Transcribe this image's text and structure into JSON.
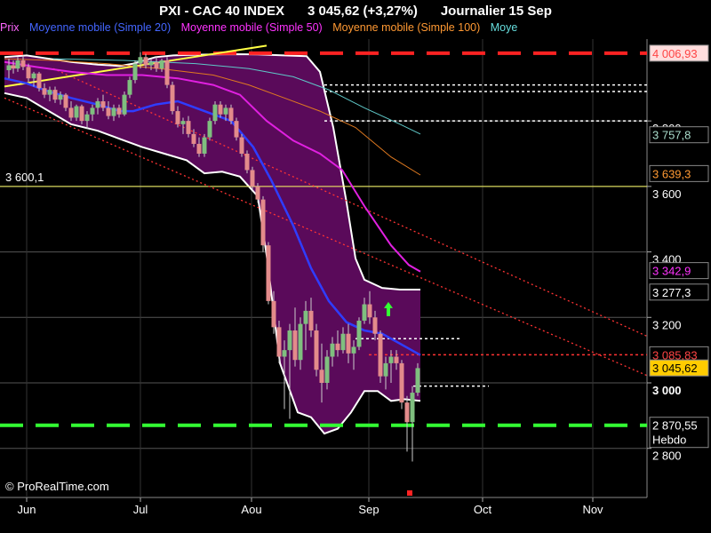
{
  "header": {
    "instrument": "PXI - CAC 40 INDEX",
    "price": "3 045,62 (+3,27%)",
    "period": "Journalier  15 Sep"
  },
  "legend": [
    {
      "label": "Prix",
      "color": "#ff66ff"
    },
    {
      "label": "Moyenne mobile (Simple 20)",
      "color": "#4466ff"
    },
    {
      "label": "Moyenne mobile (Simple 50)",
      "color": "#ff33ff"
    },
    {
      "label": "Moyenne mobile (Simple 100)",
      "color": "#ff9933"
    },
    {
      "label": "Moye",
      "color": "#66dddd"
    }
  ],
  "watermark": "© ProRealTime.com",
  "colors": {
    "background": "#000000",
    "band_fill": "#5a0a5a",
    "bullish": "#7fbf7f",
    "bearish": "#e38b8b",
    "ma20": "#2f3dff",
    "ma50": "#e020e0",
    "ma100": "#e07a20",
    "ma200": "#5fc8c8",
    "support": "#33ff33",
    "resistance": "#ff2222",
    "trend": "#ff3333",
    "yellow": "#ffff44"
  },
  "chart_data": {
    "type": "candlestick",
    "title": "PXI - CAC 40 INDEX",
    "x_ticks": [
      "Jun",
      "Jul",
      "Aou",
      "Sep",
      "Oct",
      "Nov"
    ],
    "y_ticks": [
      {
        "value": 2800,
        "label": "2 800"
      },
      {
        "value": 3000,
        "label": "3 000",
        "bold": true
      },
      {
        "value": 3200,
        "label": "3 200"
      },
      {
        "value": 3400,
        "label": "3 400"
      },
      {
        "value": 3600,
        "label": "3 600"
      },
      {
        "value": 3800,
        "label": "3 800"
      }
    ],
    "ylim": [
      2650,
      4050
    ],
    "grid": true,
    "price_labels": [
      {
        "value": 4006.93,
        "label": "4 006,93",
        "color": "#ff4444",
        "bg": "#ffdddd"
      },
      {
        "value": 3757.8,
        "label": "3 757,8",
        "color": "#aaddcc",
        "bg": "#000000"
      },
      {
        "value": 3639.3,
        "label": "3 639,3",
        "color": "#ff9933",
        "bg": "#000000"
      },
      {
        "value": 3342.9,
        "label": "3 342,9",
        "color": "#ff33ff",
        "bg": "#000000"
      },
      {
        "value": 3277.3,
        "label": "3 277,3",
        "color": "#ffffff",
        "bg": "#000000"
      },
      {
        "value": 3085.83,
        "label": "3 085,83",
        "color": "#ff4444",
        "bg": "#000000"
      },
      {
        "value": 3045.62,
        "label": "3 045,62",
        "color": "#000000",
        "bg": "#ffcc00"
      },
      {
        "value": 2870.55,
        "label": "2 870,55",
        "color": "#ffffff",
        "bg": "#000000",
        "sub": "Hebdo"
      }
    ],
    "hlines": [
      {
        "value": 4006.93,
        "color": "#ff2222",
        "style": "dash-long",
        "width": 4
      },
      {
        "value": 2870.55,
        "color": "#33ff33",
        "style": "dash-long",
        "width": 4
      },
      {
        "value": 3600.1,
        "color": "#ffff66",
        "style": "solid",
        "width": 1,
        "label": "3 600,1"
      },
      {
        "value": 3085.83,
        "color": "#ff3333",
        "style": "dot",
        "width": 1.5,
        "from": 415
      },
      {
        "value": 3910,
        "color": "#ffffff",
        "style": "dot",
        "width": 1.5,
        "from": 365
      },
      {
        "value": 3890,
        "color": "#ffffff",
        "style": "dot",
        "width": 1.5,
        "from": 365
      },
      {
        "value": 3800,
        "color": "#ffffff",
        "style": "dot",
        "width": 1.5,
        "from": 365
      },
      {
        "value": 3135,
        "color": "#ffffff",
        "style": "dot",
        "width": 1.5,
        "from": 400,
        "to": 520
      },
      {
        "value": 2990,
        "color": "#ffffff",
        "style": "dot",
        "width": 1.5,
        "from": 465,
        "to": 550
      }
    ],
    "band_upper": [
      [
        5,
        3995
      ],
      [
        30,
        4000
      ],
      [
        55,
        3990
      ],
      [
        80,
        3980
      ],
      [
        110,
        3972
      ],
      [
        135,
        3968
      ],
      [
        150,
        3975
      ],
      [
        175,
        3995
      ],
      [
        195,
        4000
      ],
      [
        215,
        4002
      ],
      [
        240,
        4003
      ],
      [
        265,
        4004
      ],
      [
        290,
        4003
      ],
      [
        320,
        4000
      ],
      [
        345,
        3998
      ],
      [
        360,
        3950
      ],
      [
        375,
        3780
      ],
      [
        390,
        3550
      ],
      [
        400,
        3380
      ],
      [
        410,
        3315
      ],
      [
        430,
        3290
      ],
      [
        450,
        3285
      ],
      [
        473,
        3285
      ]
    ],
    "band_lower": [
      [
        5,
        3885
      ],
      [
        30,
        3870
      ],
      [
        55,
        3830
      ],
      [
        80,
        3790
      ],
      [
        110,
        3770
      ],
      [
        135,
        3745
      ],
      [
        160,
        3720
      ],
      [
        185,
        3700
      ],
      [
        210,
        3680
      ],
      [
        230,
        3640
      ],
      [
        250,
        3645
      ],
      [
        270,
        3630
      ],
      [
        290,
        3570
      ],
      [
        300,
        3390
      ],
      [
        315,
        3060
      ],
      [
        335,
        2910
      ],
      [
        350,
        2895
      ],
      [
        365,
        2845
      ],
      [
        380,
        2860
      ],
      [
        395,
        2910
      ],
      [
        410,
        2975
      ],
      [
        425,
        2975
      ],
      [
        440,
        2945
      ],
      [
        455,
        2950
      ],
      [
        473,
        2945
      ]
    ],
    "ma20": [
      [
        5,
        3930
      ],
      [
        30,
        3915
      ],
      [
        55,
        3890
      ],
      [
        80,
        3870
      ],
      [
        110,
        3850
      ],
      [
        135,
        3830
      ],
      [
        150,
        3830
      ],
      [
        175,
        3850
      ],
      [
        200,
        3860
      ],
      [
        230,
        3830
      ],
      [
        260,
        3800
      ],
      [
        285,
        3720
      ],
      [
        305,
        3620
      ],
      [
        330,
        3480
      ],
      [
        350,
        3350
      ],
      [
        370,
        3250
      ],
      [
        390,
        3185
      ],
      [
        410,
        3160
      ],
      [
        430,
        3150
      ],
      [
        450,
        3120
      ],
      [
        473,
        3085
      ]
    ],
    "ma50": [
      [
        5,
        3980
      ],
      [
        40,
        3965
      ],
      [
        80,
        3950
      ],
      [
        120,
        3940
      ],
      [
        160,
        3940
      ],
      [
        200,
        3930
      ],
      [
        240,
        3910
      ],
      [
        270,
        3880
      ],
      [
        300,
        3800
      ],
      [
        330,
        3740
      ],
      [
        360,
        3700
      ],
      [
        385,
        3650
      ],
      [
        410,
        3540
      ],
      [
        440,
        3420
      ],
      [
        460,
        3360
      ],
      [
        473,
        3340
      ]
    ],
    "ma100": [
      [
        5,
        3990
      ],
      [
        60,
        3985
      ],
      [
        120,
        3975
      ],
      [
        180,
        3960
      ],
      [
        240,
        3940
      ],
      [
        280,
        3910
      ],
      [
        320,
        3870
      ],
      [
        360,
        3830
      ],
      [
        400,
        3780
      ],
      [
        440,
        3690
      ],
      [
        473,
        3635
      ]
    ],
    "ma200": [
      [
        60,
        3990
      ],
      [
        140,
        3985
      ],
      [
        220,
        3975
      ],
      [
        280,
        3960
      ],
      [
        330,
        3935
      ],
      [
        370,
        3895
      ],
      [
        410,
        3840
      ],
      [
        450,
        3790
      ],
      [
        473,
        3760
      ]
    ],
    "trend_lines": [
      {
        "points": [
          [
            5,
            3870
          ],
          [
            730,
            3020
          ]
        ],
        "color": "#ff3333"
      },
      {
        "points": [
          [
            60,
            3960
          ],
          [
            730,
            3140
          ]
        ],
        "color": "#ff3333"
      }
    ],
    "yellow_line": {
      "points": [
        [
          5,
          3905
        ],
        [
          300,
          4030
        ]
      ],
      "color": "#ffff44"
    },
    "candles": [
      {
        "x": 10,
        "o": 3955,
        "h": 3990,
        "l": 3930,
        "c": 3970
      },
      {
        "x": 15,
        "o": 3970,
        "h": 3985,
        "l": 3945,
        "c": 3960
      },
      {
        "x": 20,
        "o": 3960,
        "h": 3995,
        "l": 3950,
        "c": 3985
      },
      {
        "x": 26,
        "o": 3985,
        "h": 4000,
        "l": 3955,
        "c": 3965
      },
      {
        "x": 32,
        "o": 3965,
        "h": 3975,
        "l": 3920,
        "c": 3930
      },
      {
        "x": 38,
        "o": 3930,
        "h": 3950,
        "l": 3905,
        "c": 3945
      },
      {
        "x": 44,
        "o": 3945,
        "h": 3950,
        "l": 3890,
        "c": 3900
      },
      {
        "x": 50,
        "o": 3900,
        "h": 3915,
        "l": 3870,
        "c": 3880
      },
      {
        "x": 56,
        "o": 3880,
        "h": 3905,
        "l": 3860,
        "c": 3895
      },
      {
        "x": 62,
        "o": 3895,
        "h": 3905,
        "l": 3855,
        "c": 3865
      },
      {
        "x": 68,
        "o": 3865,
        "h": 3890,
        "l": 3850,
        "c": 3880
      },
      {
        "x": 74,
        "o": 3880,
        "h": 3885,
        "l": 3830,
        "c": 3840
      },
      {
        "x": 80,
        "o": 3840,
        "h": 3860,
        "l": 3800,
        "c": 3810
      },
      {
        "x": 86,
        "o": 3810,
        "h": 3850,
        "l": 3800,
        "c": 3845
      },
      {
        "x": 92,
        "o": 3845,
        "h": 3850,
        "l": 3790,
        "c": 3800
      },
      {
        "x": 98,
        "o": 3800,
        "h": 3830,
        "l": 3775,
        "c": 3820
      },
      {
        "x": 104,
        "o": 3820,
        "h": 3850,
        "l": 3800,
        "c": 3840
      },
      {
        "x": 110,
        "o": 3840,
        "h": 3870,
        "l": 3820,
        "c": 3860
      },
      {
        "x": 116,
        "o": 3860,
        "h": 3880,
        "l": 3830,
        "c": 3840
      },
      {
        "x": 122,
        "o": 3840,
        "h": 3860,
        "l": 3805,
        "c": 3815
      },
      {
        "x": 128,
        "o": 3815,
        "h": 3850,
        "l": 3800,
        "c": 3840
      },
      {
        "x": 134,
        "o": 3840,
        "h": 3850,
        "l": 3810,
        "c": 3820
      },
      {
        "x": 140,
        "o": 3820,
        "h": 3890,
        "l": 3815,
        "c": 3880
      },
      {
        "x": 146,
        "o": 3880,
        "h": 3935,
        "l": 3870,
        "c": 3925
      },
      {
        "x": 152,
        "o": 3925,
        "h": 3985,
        "l": 3915,
        "c": 3975
      },
      {
        "x": 158,
        "o": 3975,
        "h": 4010,
        "l": 3960,
        "c": 3995
      },
      {
        "x": 164,
        "o": 3995,
        "h": 4005,
        "l": 3960,
        "c": 3970
      },
      {
        "x": 170,
        "o": 3970,
        "h": 3990,
        "l": 3955,
        "c": 3980
      },
      {
        "x": 176,
        "o": 3980,
        "h": 3995,
        "l": 3950,
        "c": 3960
      },
      {
        "x": 182,
        "o": 3960,
        "h": 3990,
        "l": 3950,
        "c": 3985
      },
      {
        "x": 188,
        "o": 3985,
        "h": 3995,
        "l": 3900,
        "c": 3910
      },
      {
        "x": 194,
        "o": 3910,
        "h": 3920,
        "l": 3820,
        "c": 3830
      },
      {
        "x": 200,
        "o": 3830,
        "h": 3845,
        "l": 3780,
        "c": 3790
      },
      {
        "x": 206,
        "o": 3790,
        "h": 3810,
        "l": 3760,
        "c": 3800
      },
      {
        "x": 212,
        "o": 3800,
        "h": 3815,
        "l": 3750,
        "c": 3760
      },
      {
        "x": 218,
        "o": 3760,
        "h": 3775,
        "l": 3720,
        "c": 3730
      },
      {
        "x": 224,
        "o": 3730,
        "h": 3750,
        "l": 3690,
        "c": 3700
      },
      {
        "x": 230,
        "o": 3700,
        "h": 3760,
        "l": 3690,
        "c": 3750
      },
      {
        "x": 236,
        "o": 3750,
        "h": 3810,
        "l": 3740,
        "c": 3800
      },
      {
        "x": 242,
        "o": 3800,
        "h": 3860,
        "l": 3790,
        "c": 3850
      },
      {
        "x": 248,
        "o": 3850,
        "h": 3860,
        "l": 3810,
        "c": 3820
      },
      {
        "x": 254,
        "o": 3820,
        "h": 3850,
        "l": 3800,
        "c": 3840
      },
      {
        "x": 260,
        "o": 3840,
        "h": 3850,
        "l": 3790,
        "c": 3800
      },
      {
        "x": 266,
        "o": 3800,
        "h": 3810,
        "l": 3740,
        "c": 3750
      },
      {
        "x": 272,
        "o": 3750,
        "h": 3760,
        "l": 3690,
        "c": 3700
      },
      {
        "x": 278,
        "o": 3700,
        "h": 3710,
        "l": 3640,
        "c": 3650
      },
      {
        "x": 284,
        "o": 3650,
        "h": 3660,
        "l": 3590,
        "c": 3600
      },
      {
        "x": 290,
        "o": 3600,
        "h": 3610,
        "l": 3550,
        "c": 3560
      },
      {
        "x": 296,
        "o": 3560,
        "h": 3570,
        "l": 3400,
        "c": 3420
      },
      {
        "x": 302,
        "o": 3420,
        "h": 3430,
        "l": 3240,
        "c": 3250
      },
      {
        "x": 308,
        "o": 3250,
        "h": 3280,
        "l": 3150,
        "c": 3170
      },
      {
        "x": 314,
        "o": 3170,
        "h": 3190,
        "l": 3060,
        "c": 3080
      },
      {
        "x": 320,
        "o": 3080,
        "h": 3130,
        "l": 2920,
        "c": 3100
      },
      {
        "x": 326,
        "o": 3100,
        "h": 3180,
        "l": 2890,
        "c": 3160
      },
      {
        "x": 332,
        "o": 3160,
        "h": 3230,
        "l": 3050,
        "c": 3070
      },
      {
        "x": 338,
        "o": 3070,
        "h": 3200,
        "l": 3040,
        "c": 3180
      },
      {
        "x": 344,
        "o": 3180,
        "h": 3250,
        "l": 3100,
        "c": 3220
      },
      {
        "x": 350,
        "o": 3220,
        "h": 3260,
        "l": 3140,
        "c": 3160
      },
      {
        "x": 356,
        "o": 3160,
        "h": 3180,
        "l": 3020,
        "c": 3040
      },
      {
        "x": 362,
        "o": 3040,
        "h": 3120,
        "l": 2940,
        "c": 3000
      },
      {
        "x": 368,
        "o": 3000,
        "h": 3100,
        "l": 2980,
        "c": 3080
      },
      {
        "x": 374,
        "o": 3080,
        "h": 3140,
        "l": 3050,
        "c": 3120
      },
      {
        "x": 380,
        "o": 3120,
        "h": 3160,
        "l": 3080,
        "c": 3100
      },
      {
        "x": 386,
        "o": 3100,
        "h": 3170,
        "l": 3090,
        "c": 3150
      },
      {
        "x": 392,
        "o": 3150,
        "h": 3180,
        "l": 3060,
        "c": 3090
      },
      {
        "x": 398,
        "o": 3090,
        "h": 3130,
        "l": 3040,
        "c": 3110
      },
      {
        "x": 404,
        "o": 3110,
        "h": 3200,
        "l": 3100,
        "c": 3190
      },
      {
        "x": 410,
        "o": 3190,
        "h": 3260,
        "l": 3180,
        "c": 3240
      },
      {
        "x": 416,
        "o": 3240,
        "h": 3280,
        "l": 3180,
        "c": 3200
      },
      {
        "x": 422,
        "o": 3200,
        "h": 3220,
        "l": 3130,
        "c": 3150
      },
      {
        "x": 428,
        "o": 3150,
        "h": 3160,
        "l": 3000,
        "c": 3020
      },
      {
        "x": 434,
        "o": 3020,
        "h": 3080,
        "l": 2980,
        "c": 3060
      },
      {
        "x": 440,
        "o": 3060,
        "h": 3100,
        "l": 3000,
        "c": 3080
      },
      {
        "x": 446,
        "o": 3080,
        "h": 3100,
        "l": 3040,
        "c": 3060
      },
      {
        "x": 452,
        "o": 3060,
        "h": 3070,
        "l": 2920,
        "c": 2940
      },
      {
        "x": 458,
        "o": 2940,
        "h": 2960,
        "l": 2790,
        "c": 2880
      },
      {
        "x": 464,
        "o": 2880,
        "h": 2990,
        "l": 2760,
        "c": 2970
      },
      {
        "x": 470,
        "o": 2970,
        "h": 3060,
        "l": 2960,
        "c": 3045
      }
    ],
    "arrows": [
      {
        "x": 437,
        "value": 3220,
        "dir": "up",
        "color": "#33ff33"
      },
      {
        "x": 461,
        "value": 2650,
        "dir": "marker",
        "color": "#ff2222"
      }
    ]
  }
}
